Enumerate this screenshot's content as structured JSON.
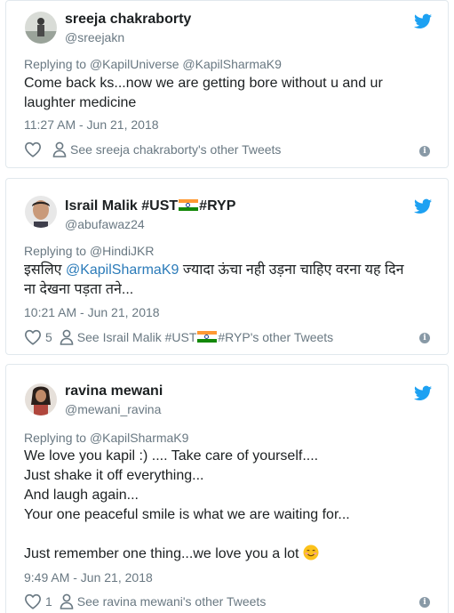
{
  "tweets": [
    {
      "display_name": "sreeja chakraborty",
      "handle": "@sreejakn",
      "replying_prefix": "Replying to",
      "replying_to": "@KapilUniverse @KapilSharmaK9",
      "lines": [
        "Come back ks...now we are getting bore without u and ur",
        "laughter medicine"
      ],
      "time": "11:27 AM - Jun 21, 2018",
      "likes": "",
      "see_tweets": "See sreeja chakraborty's other Tweets"
    },
    {
      "display_name_a": "Israil Malik #UST",
      "display_name_b": "#RYP",
      "handle": "@abufawaz24",
      "replying_prefix": "Replying to",
      "replying_to": "@HindiJKR",
      "line1_a": "इसलिए",
      "line1_mention": "@KapilSharmaK9",
      "line1_b": "ज्यादा ऊंचा नही उड़ना चाहिए वरना यह दिन",
      "line2": "ना देखना पड़ता तने...",
      "time": "10:21 AM - Jun 21, 2018",
      "likes": "5",
      "see_tweets_a": "See Israil Malik #UST",
      "see_tweets_b": "#RYP's other Tweets"
    },
    {
      "display_name": "ravina mewani",
      "handle": "@mewani_ravina",
      "replying_prefix": "Replying to",
      "replying_to": "@KapilSharmaK9",
      "lines": [
        "We love you kapil :)  .... Take care of yourself....",
        "Just shake it off everything...",
        "And laugh again...",
        "Your one peaceful smile is what we are waiting for...",
        "",
        "Just remember one thing...we love you a lot"
      ],
      "time": "9:49 AM - Jun 21, 2018",
      "likes": "1",
      "see_tweets": "See ravina mewani's other Tweets"
    }
  ],
  "icons": {
    "twitter_bird": "twitter-bird-icon",
    "heart": "heart-icon",
    "person": "person-icon",
    "info": "info-icon",
    "flag": "india-flag-emoji",
    "smile": "smiling-face-emoji"
  },
  "colors": {
    "twitter_blue": "#1da1f2",
    "link_blue": "#2b7bb9",
    "secondary_text": "#697882",
    "border": "#e1e8ed"
  },
  "info_glyph": "i"
}
